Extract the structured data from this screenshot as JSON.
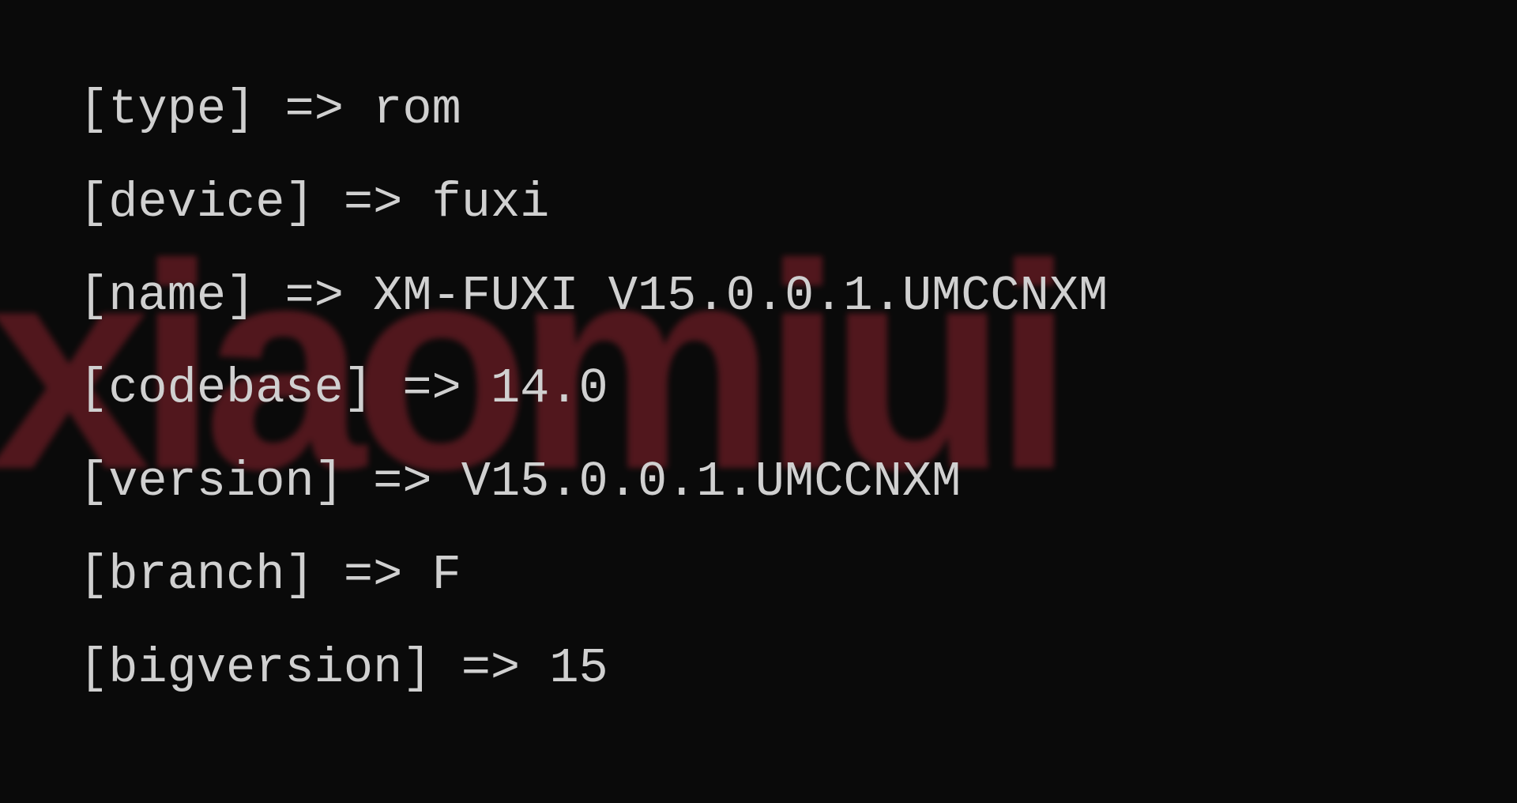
{
  "watermark_text": "xiaomiui",
  "entries": [
    {
      "key": "type",
      "value": "rom"
    },
    {
      "key": "device",
      "value": "fuxi"
    },
    {
      "key": "name",
      "value": "XM-FUXI V15.0.0.1.UMCCNXM"
    },
    {
      "key": "codebase",
      "value": "14.0"
    },
    {
      "key": "version",
      "value": "V15.0.0.1.UMCCNXM"
    },
    {
      "key": "branch",
      "value": "F"
    },
    {
      "key": "bigversion",
      "value": "15"
    }
  ]
}
